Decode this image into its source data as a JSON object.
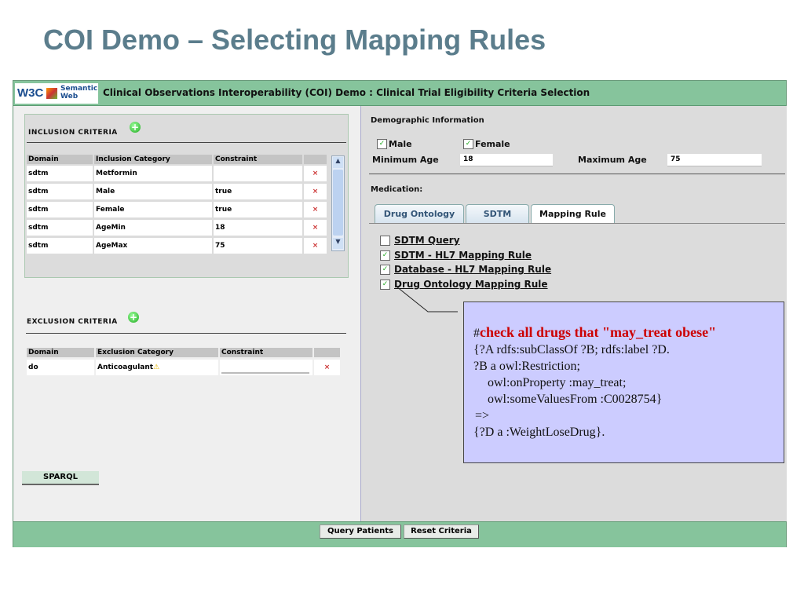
{
  "slide_title": "COI Demo – Selecting Mapping Rules",
  "app": {
    "logo_w3c": "W3C",
    "logo_sw": "Semantic Web",
    "title": "Clinical Observations Interoperability (COI) Demo : Clinical Trial Eligibility Criteria Selection"
  },
  "inclusion": {
    "heading": "INCLUSION CRITERIA",
    "columns": [
      "Domain",
      "Inclusion Category",
      "Constraint"
    ],
    "rows": [
      {
        "domain": "sdtm",
        "category": "Metformin",
        "constraint": ""
      },
      {
        "domain": "sdtm",
        "category": "Male",
        "constraint": "true"
      },
      {
        "domain": "sdtm",
        "category": "Female",
        "constraint": "true"
      },
      {
        "domain": "sdtm",
        "category": "AgeMin",
        "constraint": "18"
      },
      {
        "domain": "sdtm",
        "category": "AgeMax",
        "constraint": "75"
      }
    ],
    "delete_symbol": "×"
  },
  "exclusion": {
    "heading": "EXCLUSION CRITERIA",
    "columns": [
      "Domain",
      "Exclusion Category",
      "Constraint"
    ],
    "rows": [
      {
        "domain": "do",
        "category": "Anticoagulant",
        "constraint": ""
      }
    ],
    "delete_symbol": "×"
  },
  "sparql_label": "SPARQL",
  "demographic": {
    "heading": "Demographic Information",
    "male": "Male",
    "female": "Female",
    "min_label": "Minimum Age",
    "min_value": "18",
    "max_label": "Maximum Age",
    "max_value": "75"
  },
  "medication": {
    "heading": "Medication:",
    "tabs": [
      "Drug Ontology",
      "SDTM",
      "Mapping Rule"
    ],
    "active_tab": "Mapping Rule",
    "rules": [
      {
        "label": "SDTM Query",
        "checked": false
      },
      {
        "label": "SDTM - HL7 Mapping Rule",
        "checked": true
      },
      {
        "label": "Database - HL7 Mapping Rule",
        "checked": true
      },
      {
        "label": "Drug Ontology Mapping Rule",
        "checked": true
      }
    ]
  },
  "callout": {
    "hash": "#",
    "heading": "check all drugs that \"may_treat obese\"",
    "lines": [
      "{?A rdfs:subClassOf ?B; rdfs:label ?D.",
      "?B a owl:Restriction;",
      "owl:onProperty :may_treat;",
      "owl:someValuesFrom :C0028754}",
      "=>",
      "{?D a :WeightLoseDrug}."
    ]
  },
  "footer": {
    "query": "Query Patients",
    "reset": "Reset Criteria"
  },
  "check_mark": "✓"
}
